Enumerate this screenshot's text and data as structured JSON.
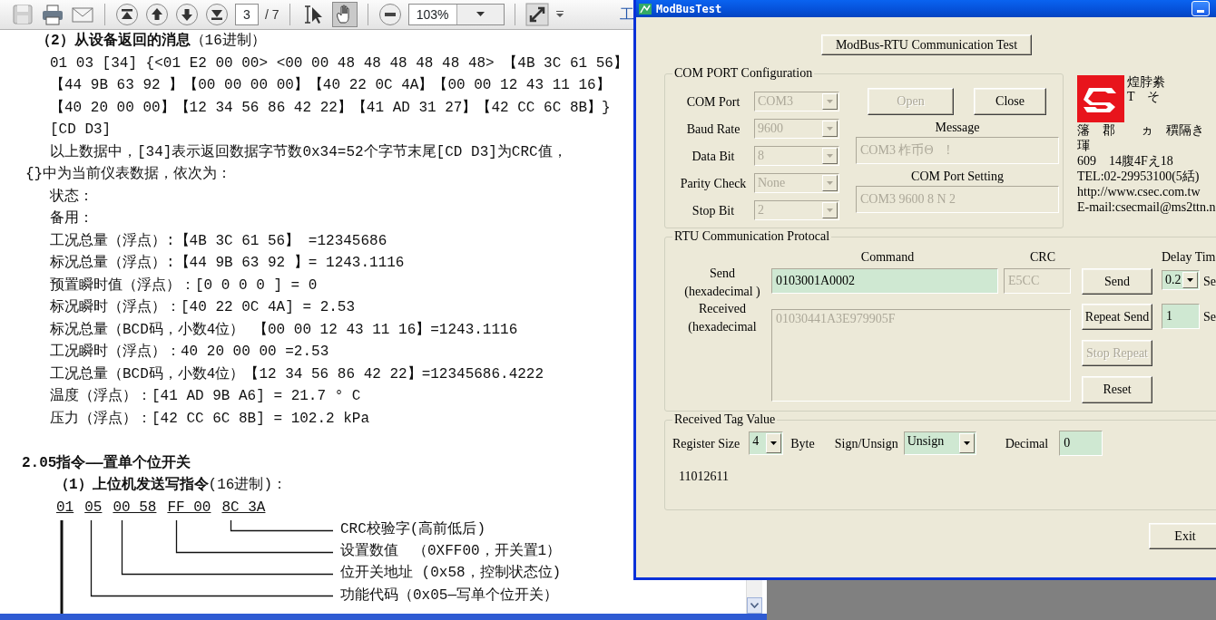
{
  "viewer_toolbar": {
    "page_number": "3",
    "page_total": "/ 7",
    "zoom": "103%",
    "cut_label": "工",
    "select_tools": [
      {
        "kind": "select",
        "selected": false
      },
      {
        "kind": "hand",
        "selected": true
      }
    ]
  },
  "document": {
    "lines": [
      {
        "kind": "heading",
        "text": "**（2）从设备返回的消息**（16进制）"
      },
      {
        "kind": "body",
        "text": "01 03 [34] {<01 E2 00 00> <00 00 48 48 48 48 48 48> 【4B 3C 61 56】"
      },
      {
        "kind": "body",
        "text": "【44 9B 63 92 】【00 00 00 00】【40 22 0C 4A】【00 00 12 43 11 16】"
      },
      {
        "kind": "body",
        "text": "【40 20 00 00】【12 34 56 86 42 22】【41 AD 31 27】【42 CC 6C 8B】}"
      },
      {
        "kind": "body",
        "text": "[CD D3]"
      },
      {
        "kind": "body",
        "text": "以上数据中，[34]表示返回数据字节数0x34=52个字节末尾[CD D3]为CRC值，"
      },
      {
        "kind": "continuation",
        "text": "{}中为当前仪表数据，依次为："
      },
      {
        "kind": "body",
        "text": "状态："
      },
      {
        "kind": "body",
        "text": "备用："
      },
      {
        "kind": "body",
        "text": "工况总量（浮点）:【4B 3C 61 56】 =12345686"
      },
      {
        "kind": "body",
        "text": "标况总量（浮点）:【44 9B 63 92 】= 1243.1116"
      },
      {
        "kind": "body",
        "text": "预置瞬时值（浮点）：[0 0 0 0 ] = 0"
      },
      {
        "kind": "body",
        "text": "标况瞬时（浮点）：[40 22 0C 4A] = 2.53"
      },
      {
        "kind": "body",
        "text": "标况总量（BCD码，小数4位） 【00 00 12 43 11 16】=1243.1116"
      },
      {
        "kind": "body",
        "text": "工况瞬时（浮点）：40 20 00 00 =2.53"
      },
      {
        "kind": "body",
        "text": "工况总量（BCD码，小数4位）【12 34 56 86 42 22】=12345686.4222"
      },
      {
        "kind": "body",
        "text": "温度（浮点）：[41 AD 9B A6] = 21.7 ° C"
      },
      {
        "kind": "body",
        "text": "压力（浮点）：[42 CC 6C 8B] = 102.2 kPa"
      },
      {
        "kind": "section",
        "text": "2.05指令——置单个位开关"
      },
      {
        "kind": "subheading",
        "text": "**（1）上位机发送写指令**(16进制)："
      }
    ],
    "diagram": {
      "codes": [
        "01",
        "05",
        "00 58",
        "FF 00",
        "8C 3A"
      ],
      "annotations": [
        "CRC校验字(高前低后)",
        "设置数值　（0XFF00，开关置1）",
        "位开关地址 (0x58，控制状态位)",
        "功能代码（0x05—写单个位开关）"
      ]
    }
  },
  "window": {
    "title": "ModBusTest",
    "heading_button": "ModBus-RTU Communication Test",
    "com_port": {
      "legend": "COM PORT Configuration",
      "settings": [
        {
          "label": "COM Port",
          "value": "COM3",
          "disabled": true
        },
        {
          "label": "Baud Rate",
          "value": "9600",
          "disabled": true
        },
        {
          "label": "Data Bit",
          "value": "8",
          "disabled": true
        },
        {
          "label": "Parity Check",
          "value": "None",
          "disabled": true
        },
        {
          "label": "Stop Bit",
          "value": "2",
          "disabled": true
        }
      ],
      "open_button": {
        "label": "Open",
        "disabled": true
      },
      "close_button": {
        "label": "Close",
        "disabled": false
      },
      "message_label": "Message",
      "message": "COM3 柞币Θ　!",
      "setting_label": "COM Port Setting",
      "setting": "COM3 9600 8 N 2"
    },
    "company": {
      "name_lines": [
        "煌脖絭",
        "T　そ"
      ],
      "address_lines": [
        "籓　郡　　ヵ　穓隔き",
        "琿",
        "609　14腹4Fえ18",
        "TEL:02-29953100(5絬)",
        "http://www.csec.com.tw",
        "E-mail:csecmail@ms2ttn.n"
      ]
    },
    "protocol": {
      "legend": "RTU Communication Protocal",
      "command_label": "Command",
      "crc_label": "CRC",
      "delay_label": "Delay Tim",
      "send_label": "Send\n(hexadecimal )",
      "command": "0103001A0002",
      "crc": "E5CC",
      "send_button": {
        "label": "Send",
        "disabled": false
      },
      "delay": "0.2",
      "delay_unit": "Se",
      "received_label": "Received\n(hexadecimal",
      "received": "01030441A3E979905F",
      "repeat_button": {
        "label": "Repeat Send",
        "disabled": false
      },
      "repeat_count": "1",
      "repeat_unit": "Se",
      "stop_button": {
        "label": "Stop Repeat",
        "disabled": true
      },
      "reset_button": {
        "label": "Reset",
        "disabled": false
      }
    },
    "tag": {
      "legend": "Received Tag Value",
      "register_size_label": "Register Size",
      "register_size": "4",
      "byte_label": "Byte",
      "sign_label": "Sign/Unsign",
      "sign": "Unsign",
      "decimal_label": "Decimal",
      "decimal": "0",
      "value": "11012611"
    },
    "exit_button": "Exit"
  }
}
